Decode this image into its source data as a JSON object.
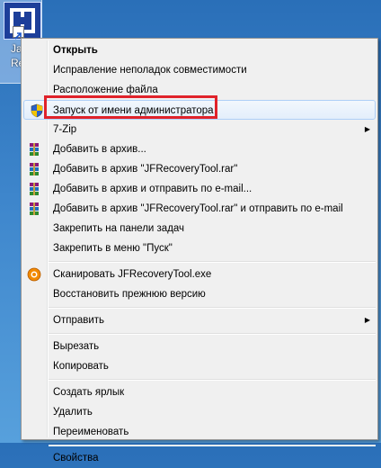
{
  "desktop_icon": {
    "label": "Ja\nRe"
  },
  "menu": {
    "items": [
      {
        "label": "Открыть",
        "bold": true
      },
      {
        "label": "Исправление неполадок совместимости"
      },
      {
        "label": "Расположение файла"
      },
      {
        "label": "Запуск от имени администратора",
        "icon": "shield-icon",
        "highlighted": true
      },
      {
        "label": "7-Zip",
        "submenu": true
      },
      {
        "label": "Добавить в архив...",
        "icon": "winrar-icon"
      },
      {
        "label": "Добавить в архив \"JFRecoveryTool.rar\"",
        "icon": "winrar-icon"
      },
      {
        "label": "Добавить в архив и отправить по e-mail...",
        "icon": "winrar-icon"
      },
      {
        "label": "Добавить в архив \"JFRecoveryTool.rar\" и отправить по e-mail",
        "icon": "winrar-icon"
      },
      {
        "label": "Закрепить на панели задач"
      },
      {
        "label": "Закрепить в меню \"Пуск\""
      },
      {
        "label": "Сканировать JFRecoveryTool.exe",
        "icon": "antivirus-icon"
      },
      {
        "label": "Восстановить прежнюю версию"
      },
      {
        "label": "Отправить",
        "submenu": true
      },
      {
        "label": "Вырезать"
      },
      {
        "label": "Копировать"
      },
      {
        "label": "Создать ярлык"
      },
      {
        "label": "Удалить"
      },
      {
        "label": "Переименовать"
      },
      {
        "label": "Свойства"
      }
    ],
    "submenu_arrow": "▶",
    "highlight_color": "#e0222a"
  }
}
